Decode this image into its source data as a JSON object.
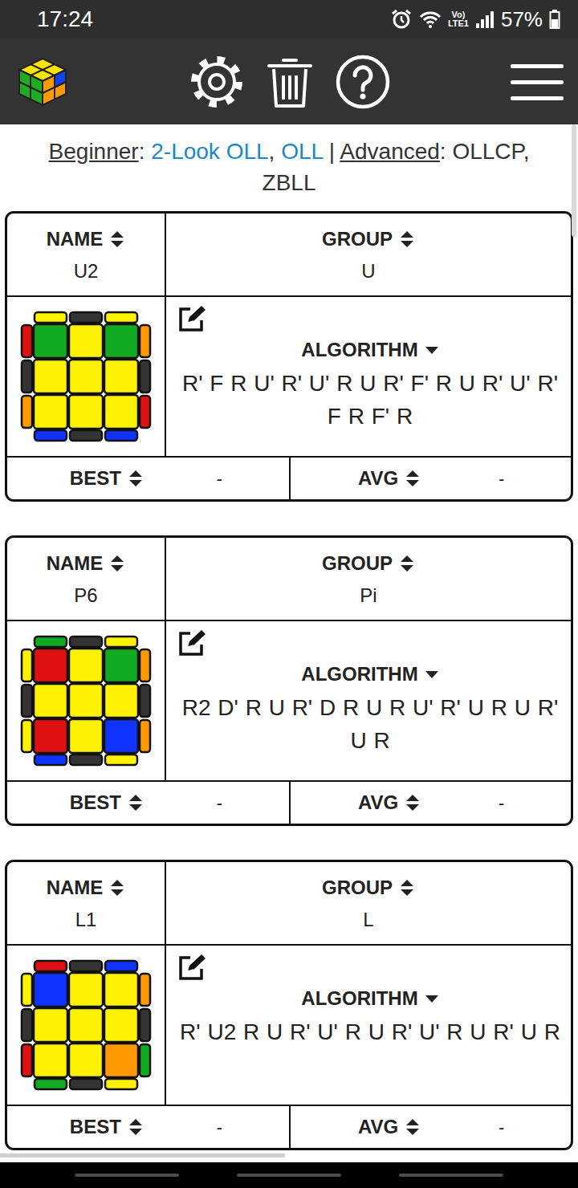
{
  "status_bar": {
    "time": "17:24",
    "volte": "Vo)",
    "lte": "LTE1",
    "battery": "57%",
    "battery_level": 0.57
  },
  "nav": {
    "label_suffix": ":",
    "item_separator": ", ",
    "group_separator": " | ",
    "groups": [
      {
        "label": "Beginner",
        "items": [
          {
            "text": "2-Look OLL",
            "linked": true
          },
          {
            "text": "OLL",
            "linked": true
          }
        ]
      },
      {
        "label": "Advanced",
        "items": [
          {
            "text": "OLLCP",
            "linked": false
          },
          {
            "text": "ZBLL",
            "linked": false
          }
        ]
      }
    ]
  },
  "headers": {
    "name": "NAME",
    "group": "GROUP",
    "algorithm": "ALGORITHM",
    "best": "BEST",
    "avg": "AVG"
  },
  "cases": [
    {
      "name": "U2",
      "group": "U",
      "algorithm": "R' F R U' R' U' R U R' F' R U R' U' R' F R F' R",
      "best": "-",
      "avg": "-",
      "diagram": {
        "top": [
          "#fef200",
          "#333333",
          "#fef200"
        ],
        "face": [
          [
            "#11aa22",
            "#fef200",
            "#11aa22"
          ],
          [
            "#fef200",
            "#fef200",
            "#fef200"
          ],
          [
            "#fef200",
            "#fef200",
            "#fef200"
          ]
        ],
        "left": [
          "#dd1111",
          "#333333",
          "#ff9900"
        ],
        "right": [
          "#ff9900",
          "#333333",
          "#dd1111"
        ],
        "bottom": [
          "#1133ff",
          "#333333",
          "#1133ff"
        ]
      }
    },
    {
      "name": "P6",
      "group": "Pi",
      "algorithm": "R2 D' R U R' D R U R U' R' U R U R' U R",
      "best": "-",
      "avg": "-",
      "diagram": {
        "top": [
          "#11aa22",
          "#333333",
          "#fef200"
        ],
        "face": [
          [
            "#dd1111",
            "#fef200",
            "#11aa22"
          ],
          [
            "#fef200",
            "#fef200",
            "#fef200"
          ],
          [
            "#dd1111",
            "#fef200",
            "#1133ff"
          ]
        ],
        "left": [
          "#fef200",
          "#333333",
          "#fef200"
        ],
        "right": [
          "#ff9900",
          "#333333",
          "#ff9900"
        ],
        "bottom": [
          "#1133ff",
          "#333333",
          "#fef200"
        ]
      }
    },
    {
      "name": "L1",
      "group": "L",
      "algorithm": "R' U2 R U R' U' R U R' U' R U R' U R",
      "best": "-",
      "avg": "-",
      "diagram": {
        "top": [
          "#dd1111",
          "#333333",
          "#1133ff"
        ],
        "face": [
          [
            "#1133ff",
            "#fef200",
            "#fef200"
          ],
          [
            "#fef200",
            "#fef200",
            "#fef200"
          ],
          [
            "#fef200",
            "#fef200",
            "#ff9900"
          ]
        ],
        "left": [
          "#fef200",
          "#333333",
          "#dd1111"
        ],
        "right": [
          "#ff9900",
          "#333333",
          "#11aa22"
        ],
        "bottom": [
          "#11aa22",
          "#333333",
          "#fef200"
        ]
      }
    }
  ]
}
